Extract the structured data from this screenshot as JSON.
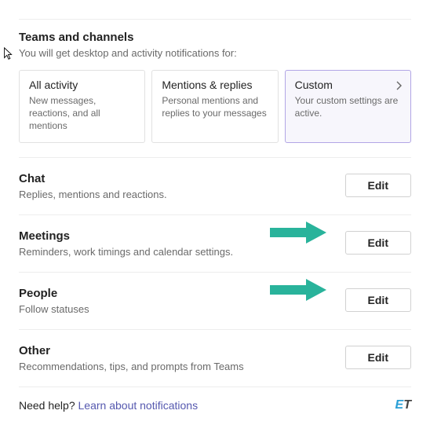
{
  "teams_channels": {
    "title": "Teams and channels",
    "subtitle": "You will get desktop and activity notifications for:",
    "cards": [
      {
        "title": "All activity",
        "desc": "New messages, reactions, and all mentions"
      },
      {
        "title": "Mentions & replies",
        "desc": "Personal mentions and replies to your messages"
      },
      {
        "title": "Custom",
        "desc": "Your custom settings are active."
      }
    ]
  },
  "sections": {
    "chat": {
      "title": "Chat",
      "desc": "Replies, mentions and reactions.",
      "button": "Edit"
    },
    "meetings": {
      "title": "Meetings",
      "desc": "Reminders, work timings and calendar settings.",
      "button": "Edit"
    },
    "people": {
      "title": "People",
      "desc": "Follow statuses",
      "button": "Edit"
    },
    "other": {
      "title": "Other",
      "desc": "Recommendations, tips, and prompts from Teams",
      "button": "Edit"
    }
  },
  "help": {
    "prefix": "Need help? ",
    "link": "Learn about notifications"
  },
  "watermark": {
    "e": "E",
    "t": "T"
  },
  "arrow_color": "#29b39b"
}
